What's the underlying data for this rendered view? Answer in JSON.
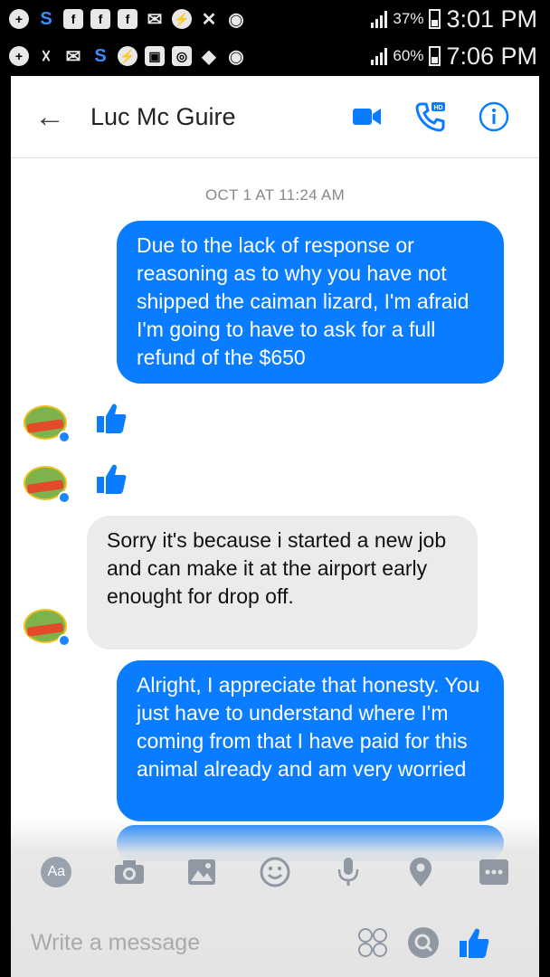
{
  "status_bar_1": {
    "battery_pct": "37%",
    "time": "3:01 PM"
  },
  "status_bar_2": {
    "battery_pct": "60%",
    "time": "7:06 PM"
  },
  "header": {
    "contact_name": "Luc Mc Guire"
  },
  "conversation": {
    "timestamp": "OCT 1 AT 11:24 AM",
    "messages": [
      {
        "sender": "me",
        "text": "Due to the lack of response or reasoning as to why you have not shipped the caiman lizard, I'm afraid I'm going to have to ask for a full refund of the $650"
      },
      {
        "sender": "them",
        "type": "like"
      },
      {
        "sender": "them",
        "type": "like"
      },
      {
        "sender": "them",
        "text": "Sorry it's because i started a new job and can make it at the airport early enought for drop off."
      },
      {
        "sender": "me",
        "text": "Alright, I appreciate that honesty. You just have to understand where I'm coming from that I have paid for this animal already and am very worried"
      }
    ]
  },
  "toolbar": {
    "aa_label": "Aa"
  },
  "composer": {
    "placeholder": "Write a message"
  },
  "colors": {
    "messenger_blue": "#0a7cff",
    "incoming_bubble": "#ebebeb"
  }
}
